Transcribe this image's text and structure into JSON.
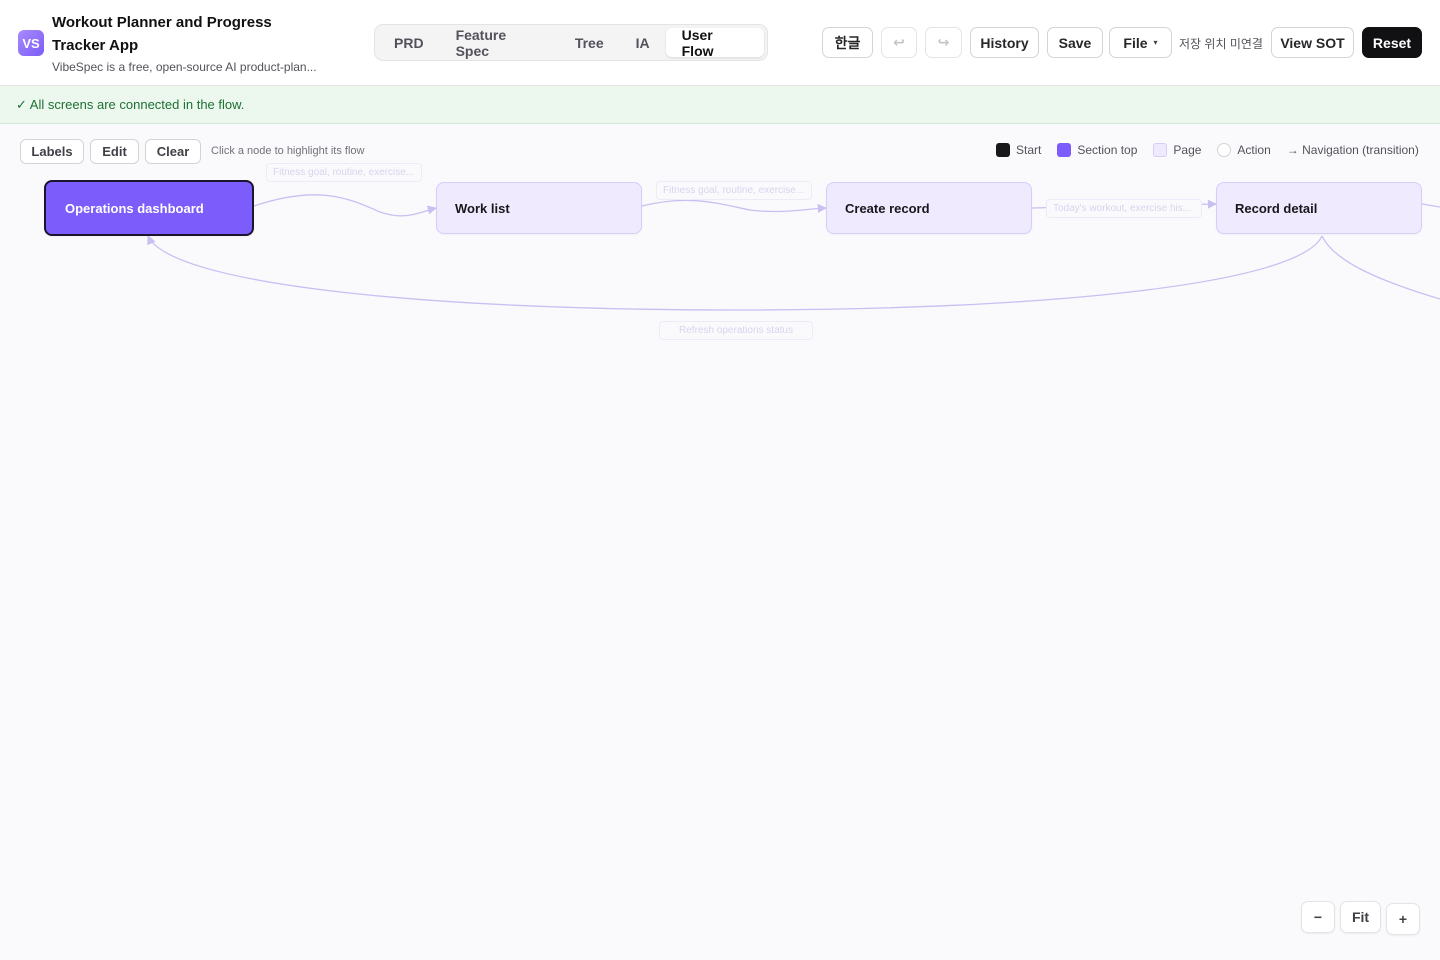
{
  "header": {
    "logo": "VS",
    "title": "Workout Planner and Progress Tracker App",
    "subtitle": "VibeSpec is a free, open-source AI product-plan...",
    "tabs": [
      {
        "label": "PRD"
      },
      {
        "label": "Feature Spec"
      },
      {
        "label": "Tree"
      },
      {
        "label": "IA"
      },
      {
        "label": "User Flow"
      }
    ],
    "active_tab": "User Flow",
    "lang_label": "한글",
    "undo_icon": "↩",
    "redo_icon": "↪",
    "history_label": "History",
    "save_label": "Save",
    "file_label": "File",
    "file_caret": "▾",
    "save_status": "저장 위치 미연결",
    "view_sot_label": "View SOT",
    "reset_label": "Reset"
  },
  "banner": {
    "text": "✓ All screens are connected in the flow."
  },
  "toolbar": {
    "labels_label": "Labels",
    "edit_label": "Edit",
    "clear_label": "Clear",
    "hint": "Click a node to highlight its flow"
  },
  "legend": {
    "start": "Start",
    "section_top": "Section top",
    "page": "Page",
    "action": "Action",
    "navigation": "→ Navigation (transition)"
  },
  "nodes": [
    {
      "label": "Operations dashboard",
      "type": "section-top"
    },
    {
      "label": "Work list",
      "type": "page"
    },
    {
      "label": "Create record",
      "type": "page"
    },
    {
      "label": "Record detail",
      "type": "page"
    }
  ],
  "edge_labels": [
    "Fitness goal, routine, exercise...",
    "Fitness goal, routine, exercise...",
    "Today's workout, exercise his...",
    "Refresh operations status"
  ],
  "zoom": {
    "minus": "−",
    "fit": "Fit",
    "plus": "+"
  },
  "colors": {
    "accent": "#7c5cfa",
    "node_fill": "#efeafe",
    "edge": "#c9bff2",
    "success": "#1f6f36"
  }
}
